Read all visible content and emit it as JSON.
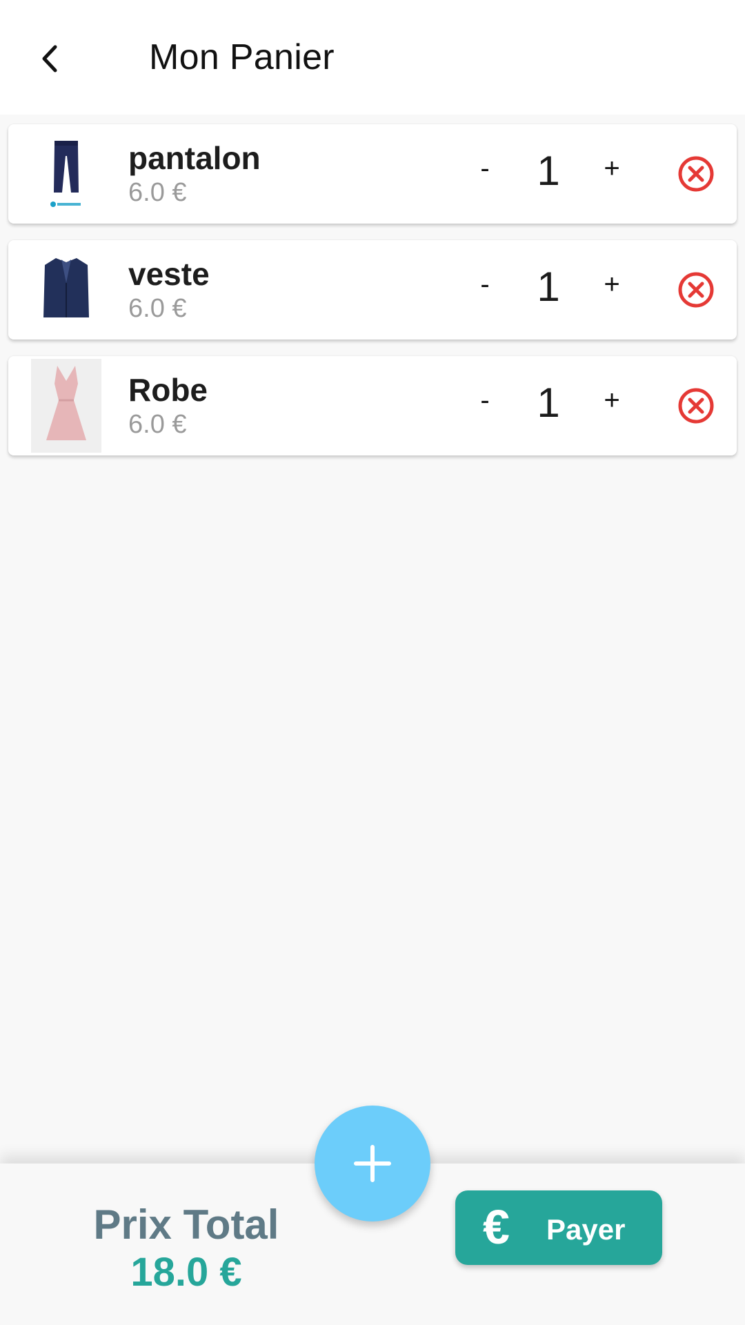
{
  "header": {
    "title": "Mon Panier",
    "back_icon": "chevron-left-icon"
  },
  "cart": {
    "items": [
      {
        "name": "pantalon",
        "price": "6.0 €",
        "quantity": "1",
        "decrement_label": "-",
        "increment_label": "+",
        "image": "pants-icon",
        "remove_icon": "remove-circle-icon"
      },
      {
        "name": "veste",
        "price": "6.0 €",
        "quantity": "1",
        "decrement_label": "-",
        "increment_label": "+",
        "image": "jacket-icon",
        "remove_icon": "remove-circle-icon"
      },
      {
        "name": "Robe",
        "price": "6.0 €",
        "quantity": "1",
        "decrement_label": "-",
        "increment_label": "+",
        "image": "dress-icon",
        "remove_icon": "remove-circle-icon"
      }
    ]
  },
  "footer": {
    "total_label": "Prix Total",
    "total_value": "18.0 €",
    "pay_label": "Payer",
    "pay_icon": "euro-icon",
    "fab_icon": "plus-icon"
  },
  "colors": {
    "accent": "#26a69a",
    "fab": "#6ccdfa",
    "remove": "#e53935",
    "total_label": "#5f7a86",
    "price": "#9a9a9a"
  }
}
